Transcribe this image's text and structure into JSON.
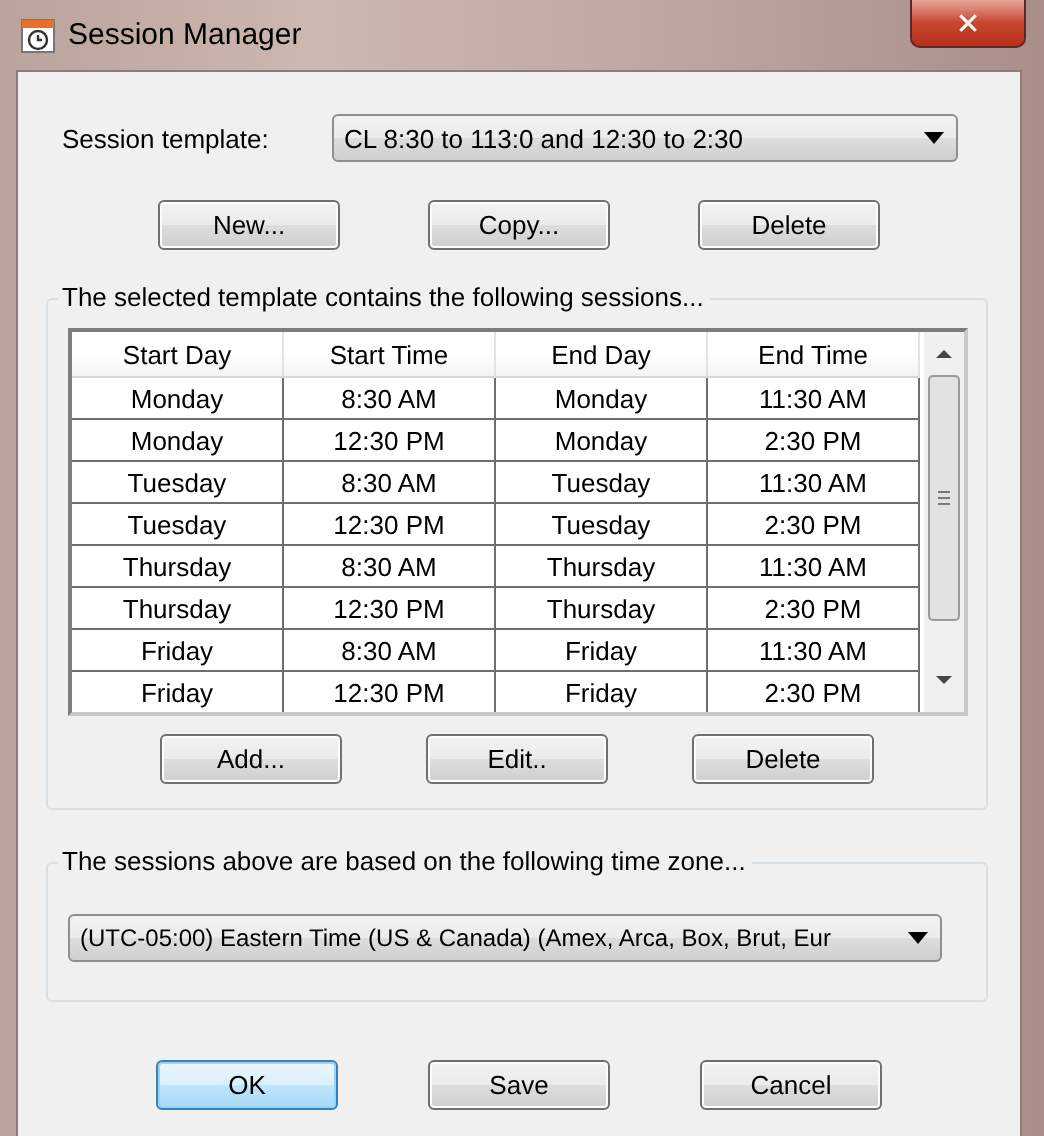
{
  "window": {
    "title": "Session Manager",
    "close": "✕"
  },
  "template": {
    "label": "Session template:",
    "value": "CL 8:30 to 113:0 and 12:30 to 2:30"
  },
  "template_buttons": [
    "New...",
    "Copy...",
    "Delete"
  ],
  "sessions": {
    "legend": "The selected template contains the following sessions...",
    "columns": [
      "Start Day",
      "Start Time",
      "End Day",
      "End Time"
    ],
    "rows": [
      [
        "Monday",
        "8:30 AM",
        "Monday",
        "11:30 AM"
      ],
      [
        "Monday",
        "12:30 PM",
        "Monday",
        "2:30 PM"
      ],
      [
        "Tuesday",
        "8:30 AM",
        "Tuesday",
        "11:30 AM"
      ],
      [
        "Tuesday",
        "12:30 PM",
        "Tuesday",
        "2:30 PM"
      ],
      [
        "Thursday",
        "8:30 AM",
        "Thursday",
        "11:30 AM"
      ],
      [
        "Thursday",
        "12:30 PM",
        "Thursday",
        "2:30 PM"
      ],
      [
        "Friday",
        "8:30 AM",
        "Friday",
        "11:30 AM"
      ],
      [
        "Friday",
        "12:30 PM",
        "Friday",
        "2:30 PM"
      ]
    ],
    "buttons": [
      "Add...",
      "Edit..",
      "Delete"
    ]
  },
  "timezone": {
    "legend": "The sessions above are based on the following time zone...",
    "value": "(UTC-05:00) Eastern Time (US & Canada) (Amex, Arca, Box, Brut, Eur"
  },
  "dialog_buttons": [
    {
      "label": "OK",
      "focused": true
    },
    {
      "label": "Save",
      "focused": false
    },
    {
      "label": "Cancel",
      "focused": false
    }
  ]
}
